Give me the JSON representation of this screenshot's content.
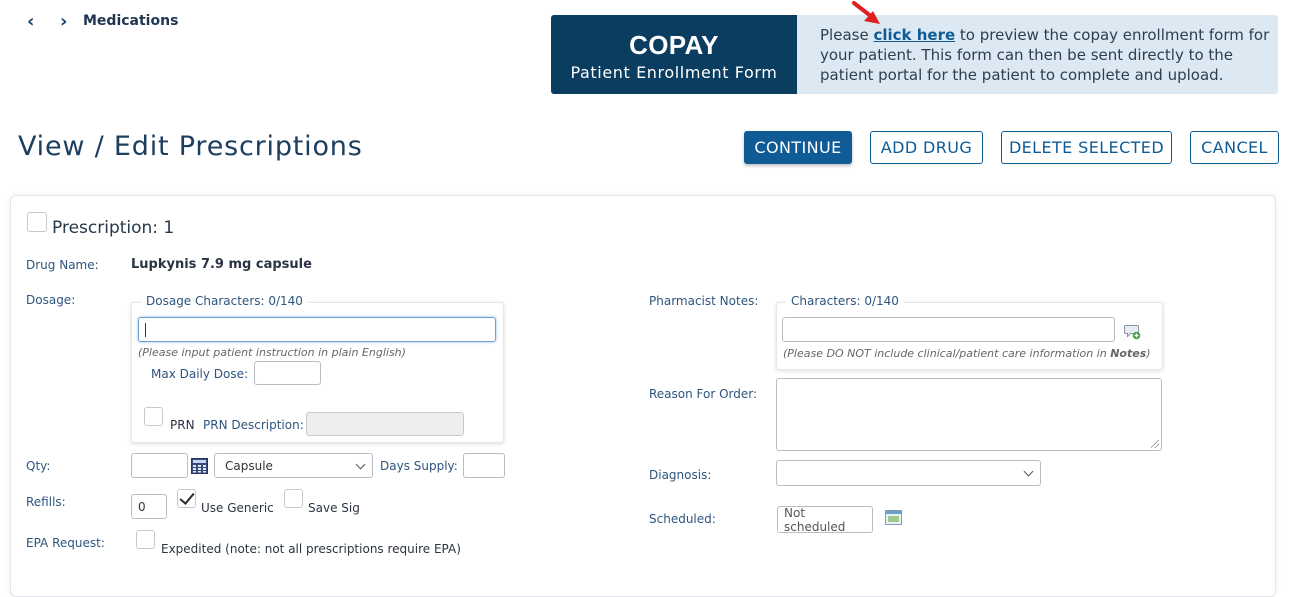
{
  "nav": {
    "back_icon": "chevron-left-icon",
    "forward_icon": "chevron-right-icon",
    "breadcrumb": "Medications"
  },
  "copay_banner": {
    "title": "COPAY",
    "subtitle": "Patient Enrollment Form",
    "text_before": "Please ",
    "link_text": "click here",
    "text_after": " to preview the copay enrollment form for your patient. This form can then be sent directly to the patient portal for the patient to complete and upload.",
    "arrow_color": "#e02020"
  },
  "header": {
    "title": "View / Edit Prescriptions",
    "buttons": {
      "continue": "CONTINUE",
      "add_drug": "ADD DRUG",
      "delete_selected": "DELETE SELECTED",
      "cancel": "CANCEL"
    }
  },
  "prescription": {
    "title": "Prescription: 1",
    "selected": false,
    "drug_name_label": "Drug Name:",
    "drug_name": "Lupkynis 7.9 mg capsule",
    "dosage_label": "Dosage:",
    "dosage_legend": "Dosage Characters: 0/140",
    "dosage_value": "",
    "dosage_hint": "(Please input patient instruction in plain English)",
    "max_daily_dose_label": "Max Daily Dose:",
    "max_daily_dose_value": "",
    "prn_label": "PRN",
    "prn_checked": false,
    "prn_description_label": "PRN Description:",
    "prn_description_value": "",
    "qty_label": "Qty:",
    "qty_value": "",
    "calculator_icon": "calculator-icon",
    "unit_selected": "Capsule",
    "days_supply_label": "Days Supply:",
    "days_supply_value": "",
    "refills_label": "Refills:",
    "refills_value": "0",
    "use_generic_label": "Use Generic",
    "use_generic_checked": true,
    "save_sig_label": "Save Sig",
    "save_sig_checked": false,
    "epa_label": "EPA Request:",
    "expedited_label": "Expedited (note: not all prescriptions require EPA)",
    "expedited_checked": false,
    "pharmacist_notes_label": "Pharmacist Notes:",
    "notes_legend": "Characters: 0/140",
    "notes_value": "",
    "notes_hint_prefix": "(Please DO NOT include clinical/patient care information in ",
    "notes_hint_bold": "Notes",
    "notes_hint_suffix": ")",
    "add_note_icon": "add-comment-icon",
    "reason_label": "Reason For Order:",
    "reason_value": "",
    "diagnosis_label": "Diagnosis:",
    "diagnosis_selected": "",
    "scheduled_label": "Scheduled:",
    "scheduled_value": "Not scheduled",
    "schedule_icon": "calendar-icon"
  }
}
